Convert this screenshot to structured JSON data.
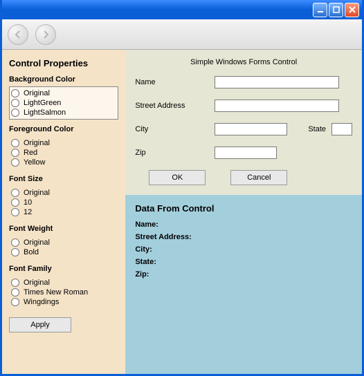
{
  "window": {
    "minimize_icon": "minimize-icon",
    "maximize_icon": "maximize-icon",
    "close_icon": "close-icon"
  },
  "sidebar": {
    "title": "Control Properties",
    "groups": {
      "bg": {
        "title": "Background Color",
        "opts": [
          "Original",
          "LightGreen",
          "LightSalmon"
        ]
      },
      "fg": {
        "title": "Foreground Color",
        "opts": [
          "Original",
          "Red",
          "Yellow"
        ]
      },
      "size": {
        "title": "Font Size",
        "opts": [
          "Original",
          "10",
          "12"
        ]
      },
      "weight": {
        "title": "Font Weight",
        "opts": [
          "Original",
          "Bold"
        ]
      },
      "family": {
        "title": "Font Family",
        "opts": [
          "Original",
          "Times New Roman",
          "Wingdings"
        ]
      }
    },
    "apply_label": "Apply"
  },
  "form": {
    "title": "Simple Windows Forms Control",
    "name_label": "Name",
    "street_label": "Street Address",
    "city_label": "City",
    "state_label": "State",
    "zip_label": "Zip",
    "ok_label": "OK",
    "cancel_label": "Cancel",
    "values": {
      "name": "",
      "street": "",
      "city": "",
      "state": "",
      "zip": ""
    }
  },
  "output": {
    "title": "Data From Control",
    "name_label": "Name:",
    "street_label": "Street Address:",
    "city_label": "City:",
    "state_label": "State:",
    "zip_label": "Zip:"
  }
}
